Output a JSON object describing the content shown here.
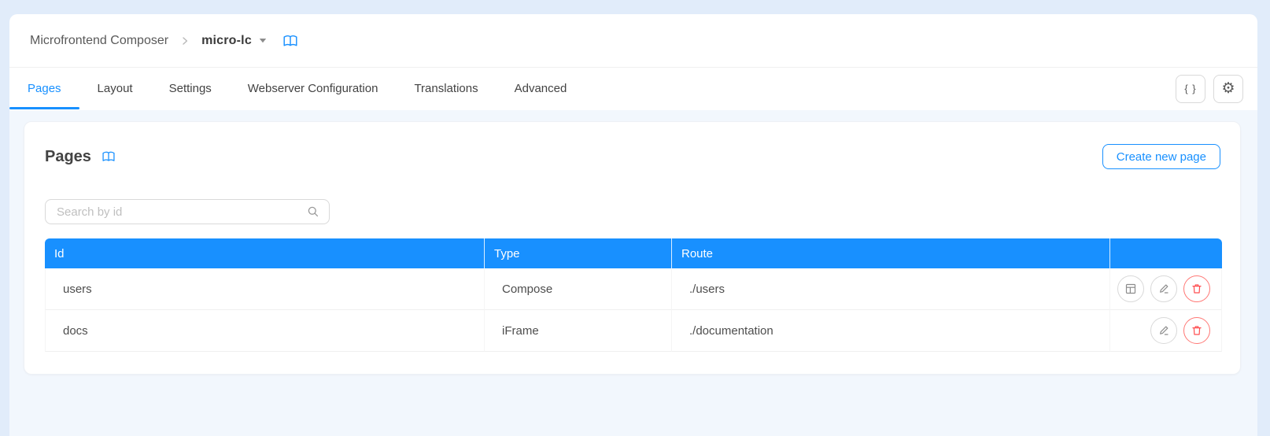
{
  "colors": {
    "accent": "#1890ff",
    "danger": "#ff4d4f",
    "header_bg": "#1890ff"
  },
  "header": {
    "breadcrumb": {
      "app_title": "Microfrontend Composer",
      "project": "micro-lc"
    },
    "tabs": [
      "Pages",
      "Layout",
      "Settings",
      "Webserver Configuration",
      "Translations",
      "Advanced"
    ],
    "active_tab": "Pages",
    "json_button_label": "{ }",
    "gear_glyph": "⚙"
  },
  "main": {
    "title": "Pages",
    "create_button_label": "Create new page",
    "search": {
      "placeholder": "Search by id"
    },
    "table": {
      "columns": [
        "Id",
        "Type",
        "Route"
      ],
      "rows": [
        {
          "id": "users",
          "type": "Compose",
          "route": "./users"
        },
        {
          "id": "docs",
          "type": "iFrame",
          "route": "./documentation"
        }
      ]
    }
  }
}
